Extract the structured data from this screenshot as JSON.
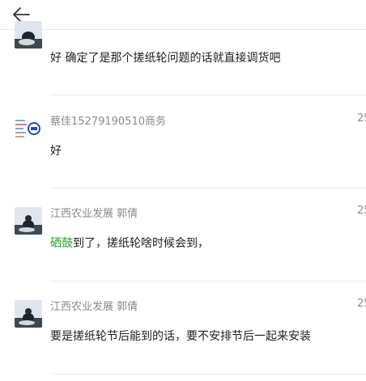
{
  "header": {
    "back_icon": "arrow-left-icon"
  },
  "messages": [
    {
      "sender": "",
      "time": "",
      "avatar": "person-photo-avatar",
      "text": "好 确定了是那个搓纸轮问题的话就直接调货吧"
    },
    {
      "sender": "蔡佳15279190510商务",
      "time": "25",
      "avatar": "company-logo-avatar",
      "text": "好"
    },
    {
      "sender": "江西农业发展 郭倩",
      "time": "25",
      "avatar": "person-photo-avatar",
      "mention": "硒鼓",
      "text": "到了，搓纸轮啥时候会到，"
    },
    {
      "sender": "江西农业发展 郭倩",
      "time": "25",
      "avatar": "person-photo-avatar",
      "text": "要是搓纸轮节后能到的话，要不安排节后一起来安装"
    }
  ],
  "colors": {
    "mention": "#2aa52a",
    "meta_text": "#8a8a8a",
    "divider": "#ececec"
  }
}
